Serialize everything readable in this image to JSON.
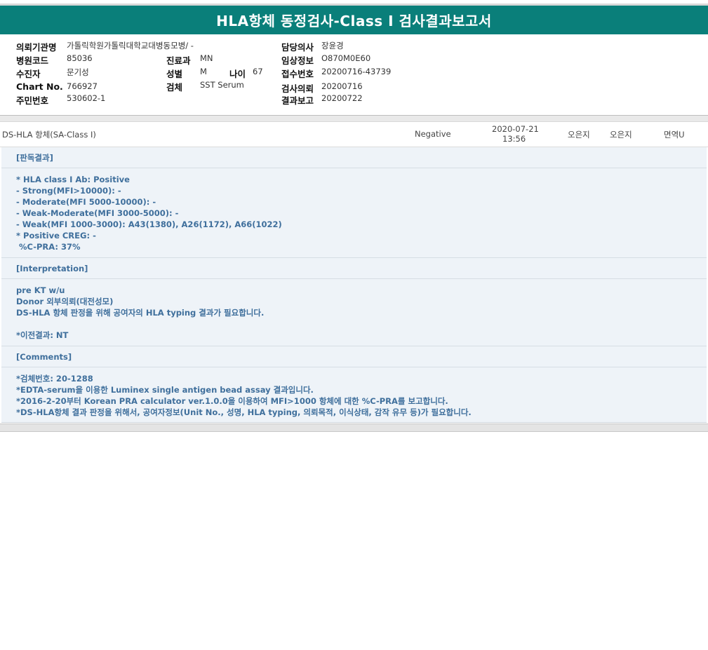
{
  "header": {
    "title": "HLA항체 동정검사-Class I 검사결과보고서"
  },
  "info": {
    "col1": [
      {
        "label": "의뢰기관명",
        "value": "가톨릭학원가톨릭대학교대병동모병/ -"
      },
      {
        "label": "병원코드",
        "value": "85036"
      },
      {
        "label": "수진자",
        "value": "문기성"
      },
      {
        "label": "Chart No.",
        "value": "766927"
      },
      {
        "label": "주민번호",
        "value": "530602-1"
      }
    ],
    "col2": [
      {
        "label": "진료과",
        "value": "MN"
      },
      {
        "label": "성별",
        "value": "M"
      },
      {
        "label": "검체",
        "value": "SST Serum"
      }
    ],
    "age": {
      "label": "나이",
      "value": "67"
    },
    "col3": [
      {
        "label": "담당의사",
        "value": "장윤경"
      },
      {
        "label": "임상정보",
        "value": "O870M0E60"
      },
      {
        "label": "접수번호",
        "value": "20200716-43739"
      },
      {
        "label": "검사의뢰",
        "value": "20200716"
      },
      {
        "label": "결과보고",
        "value": "20200722"
      }
    ]
  },
  "result_row": {
    "test_name": "DS-HLA 항체(SA-Class I)",
    "result": "Negative",
    "date": "2020-07-21",
    "time": "13:56",
    "col_a": "오은지",
    "col_b": "오은지",
    "dept": "면역U"
  },
  "sections": {
    "judgement": {
      "heading": "[판독결과]",
      "lines": [
        "* HLA class I Ab: Positive",
        "- Strong(MFI>10000): -",
        "- Moderate(MFI 5000-10000): -",
        "- Weak-Moderate(MFI 3000-5000): -",
        "- Weak(MFI 1000-3000): A43(1380), A26(1172), A66(1022)",
        "* Positive CREG: -",
        " %C-PRA: 37%"
      ]
    },
    "interpretation": {
      "heading": "[Interpretation]",
      "lines": [
        "pre KT w/u",
        "Donor 외부의뢰(대전성모)",
        "DS-HLA 항체 판정을 위해 공여자의 HLA typing 결과가 필요합니다.",
        "",
        "*이전결과: NT"
      ]
    },
    "comments": {
      "heading": "[Comments]",
      "lines": [
        "*검체번호: 20-1288",
        "*EDTA-serum을 이용한 Luminex single antigen bead assay 결과입니다.",
        "*2016-2-20부터 Korean PRA calculator ver.1.0.0을 이용하여 MFI>1000 항체에 대한 %C-PRA를 보고합니다.",
        "*DS-HLA항체 결과 판정을 위해서, 공여자정보(Unit No., 성명, HLA typing, 의뢰목적, 이식상태, 감작 유무 등)가 필요합니다."
      ]
    }
  }
}
